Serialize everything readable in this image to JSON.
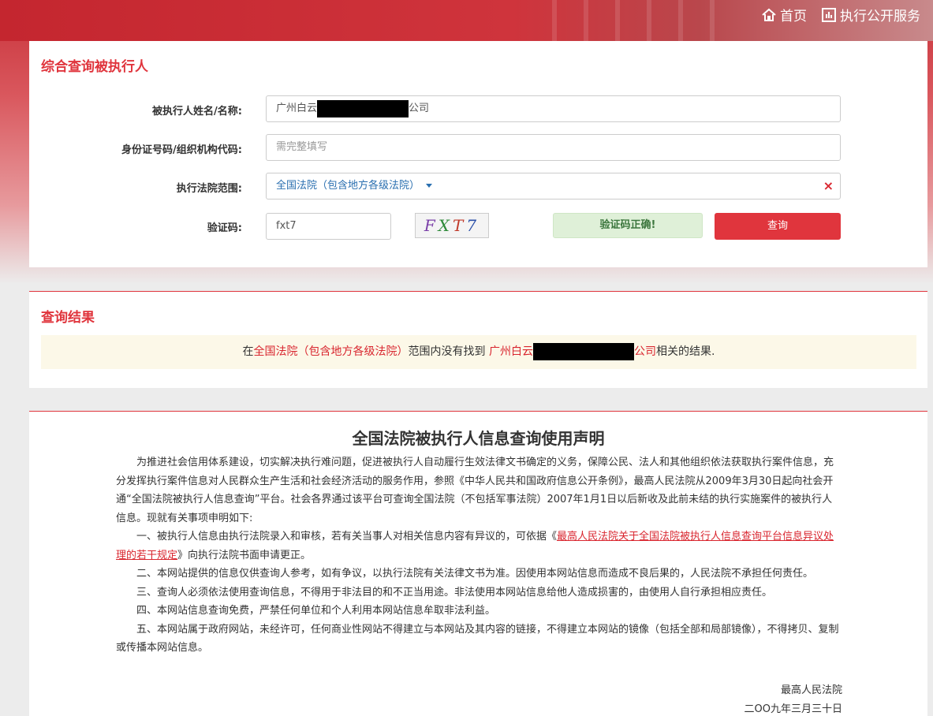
{
  "topnav": {
    "home": "首页",
    "service": "执行公开服务"
  },
  "search": {
    "title": "综合查询被执行人",
    "name_label": "被执行人姓名/名称:",
    "name_prefix": "广州白云",
    "name_suffix": "公司",
    "id_label": "身份证号码/组织机构代码:",
    "id_placeholder": "需完整填写",
    "court_label": "执行法院范围:",
    "court_value": "全国法院（包含地方各级法院）",
    "clear_icon": "×",
    "captcha_label": "验证码:",
    "captcha_value": "fxt7",
    "captcha_image_text": "FXT7",
    "captcha_ok": "验证码正确!",
    "query_button": "查询"
  },
  "result": {
    "title": "查询结果",
    "pre": "在",
    "court": "全国法院（包含地方各级法院）",
    "mid": "范围内没有找到 ",
    "name_prefix": "广州白云",
    "name_suffix": "公司",
    "post": "相关的结果."
  },
  "notice": {
    "title": "全国法院被执行人信息查询使用声明",
    "p1": "为推进社会信用体系建设，切实解决执行难问题，促进被执行人自动履行生效法律文书确定的义务，保障公民、法人和其他组织依法获取执行案件信息，充分发挥执行案件信息对人民群众生产生活和社会经济活动的服务作用，参照《中华人民共和国政府信息公开条例》，最高人民法院从2009年3月30日起向社会开通“全国法院被执行人信息查询”平台。社会各界通过该平台可查询全国法院（不包括军事法院）2007年1月1日以后新收及此前未结的执行实施案件的被执行人信息。现就有关事项申明如下:",
    "p2_pre": "一、被执行人信息由执行法院录入和审核，若有关当事人对相关信息内容有异议的，可依据《",
    "p2_link": "最高人民法院关于全国法院被执行人信息查询平台信息异议处理的若干规定",
    "p2_post": "》向执行法院书面申请更正。",
    "p3": "二、本网站提供的信息仅供查询人参考，如有争议，以执行法院有关法律文书为准。因使用本网站信息而造成不良后果的，人民法院不承担任何责任。",
    "p4": "三、查询人必须依法使用查询信息，不得用于非法目的和不正当用途。非法使用本网站信息给他人造成损害的，由使用人自行承担相应责任。",
    "p5": "四、本网站信息查询免费，严禁任何单位和个人利用本网站信息牟取非法利益。",
    "p6": "五、本网站属于政府网站，未经许可，任何商业性网站不得建立与本网站及其内容的链接，不得建立本网站的镜像（包括全部和局部镜像），不得拷贝、复制或传播本网站信息。",
    "sign_org": "最高人民法院",
    "sign_date": "二OO九年三月三十日"
  }
}
